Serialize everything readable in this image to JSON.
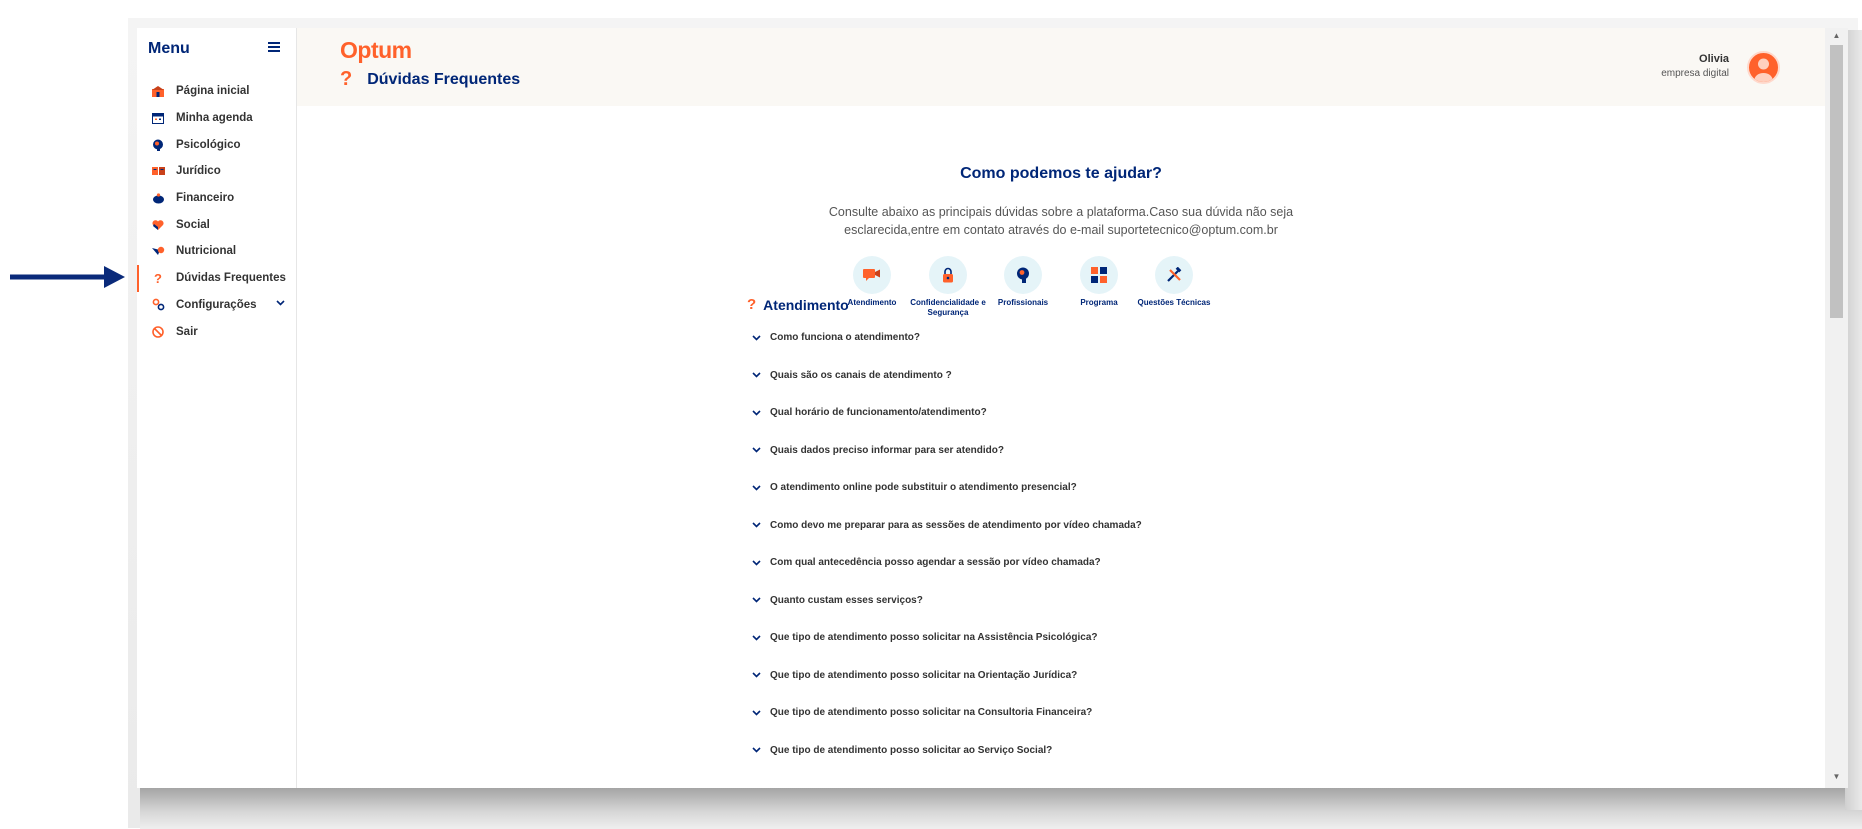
{
  "sidebar": {
    "title": "Menu",
    "items": [
      {
        "label": "Página inicial"
      },
      {
        "label": "Minha agenda"
      },
      {
        "label": "Psicológico"
      },
      {
        "label": "Jurídico"
      },
      {
        "label": "Financeiro"
      },
      {
        "label": "Social"
      },
      {
        "label": "Nutricional"
      },
      {
        "label": "Dúvidas Frequentes",
        "active": true
      },
      {
        "label": "Configurações",
        "expandable": true
      },
      {
        "label": "Sair"
      }
    ]
  },
  "header": {
    "logo": "Optum",
    "page_title_icon": "?",
    "page_title": "Dúvidas Frequentes",
    "user_name": "Olivia",
    "user_company": "empresa digital"
  },
  "main": {
    "help_title": "Como podemos te ajudar?",
    "help_description": "Consulte abaixo as principais dúvidas sobre a plataforma.Caso sua dúvida não seja esclarecida,entre em contato através do e-mail suportetecnico@optum.com.br",
    "categories": [
      {
        "label": "Atendimento",
        "icon": "video-chat-icon"
      },
      {
        "label": "Confidencialidade e Segurança",
        "icon": "lock-icon"
      },
      {
        "label": "Profissionais",
        "icon": "head-icon"
      },
      {
        "label": "Programa",
        "icon": "grid-icon"
      },
      {
        "label": "Questões Técnicas",
        "icon": "tools-icon"
      }
    ],
    "section_icon": "?",
    "section_title": "Atendimento",
    "faqs": [
      "Como funciona o atendimento?",
      "Quais são os canais de atendimento ?",
      "Qual horário de funcionamento/atendimento?",
      "Quais dados preciso informar para ser atendido?",
      "O atendimento online pode substituir o atendimento presencial?",
      "Como devo me preparar para as sessões de atendimento por vídeo chamada?",
      "Com qual antecedência posso agendar a sessão por vídeo chamada?",
      "Quanto custam esses serviços?",
      "Que tipo de atendimento posso solicitar na Assistência Psicológica?",
      "Que tipo de atendimento posso solicitar na Orientação Jurídica?",
      "Que tipo de atendimento posso solicitar na Consultoria Financeira?",
      "Que tipo de atendimento posso solicitar ao Serviço Social?"
    ]
  },
  "colors": {
    "brand_orange": "#ff612b",
    "brand_navy": "#002677",
    "category_bg": "#e5f4f8"
  }
}
